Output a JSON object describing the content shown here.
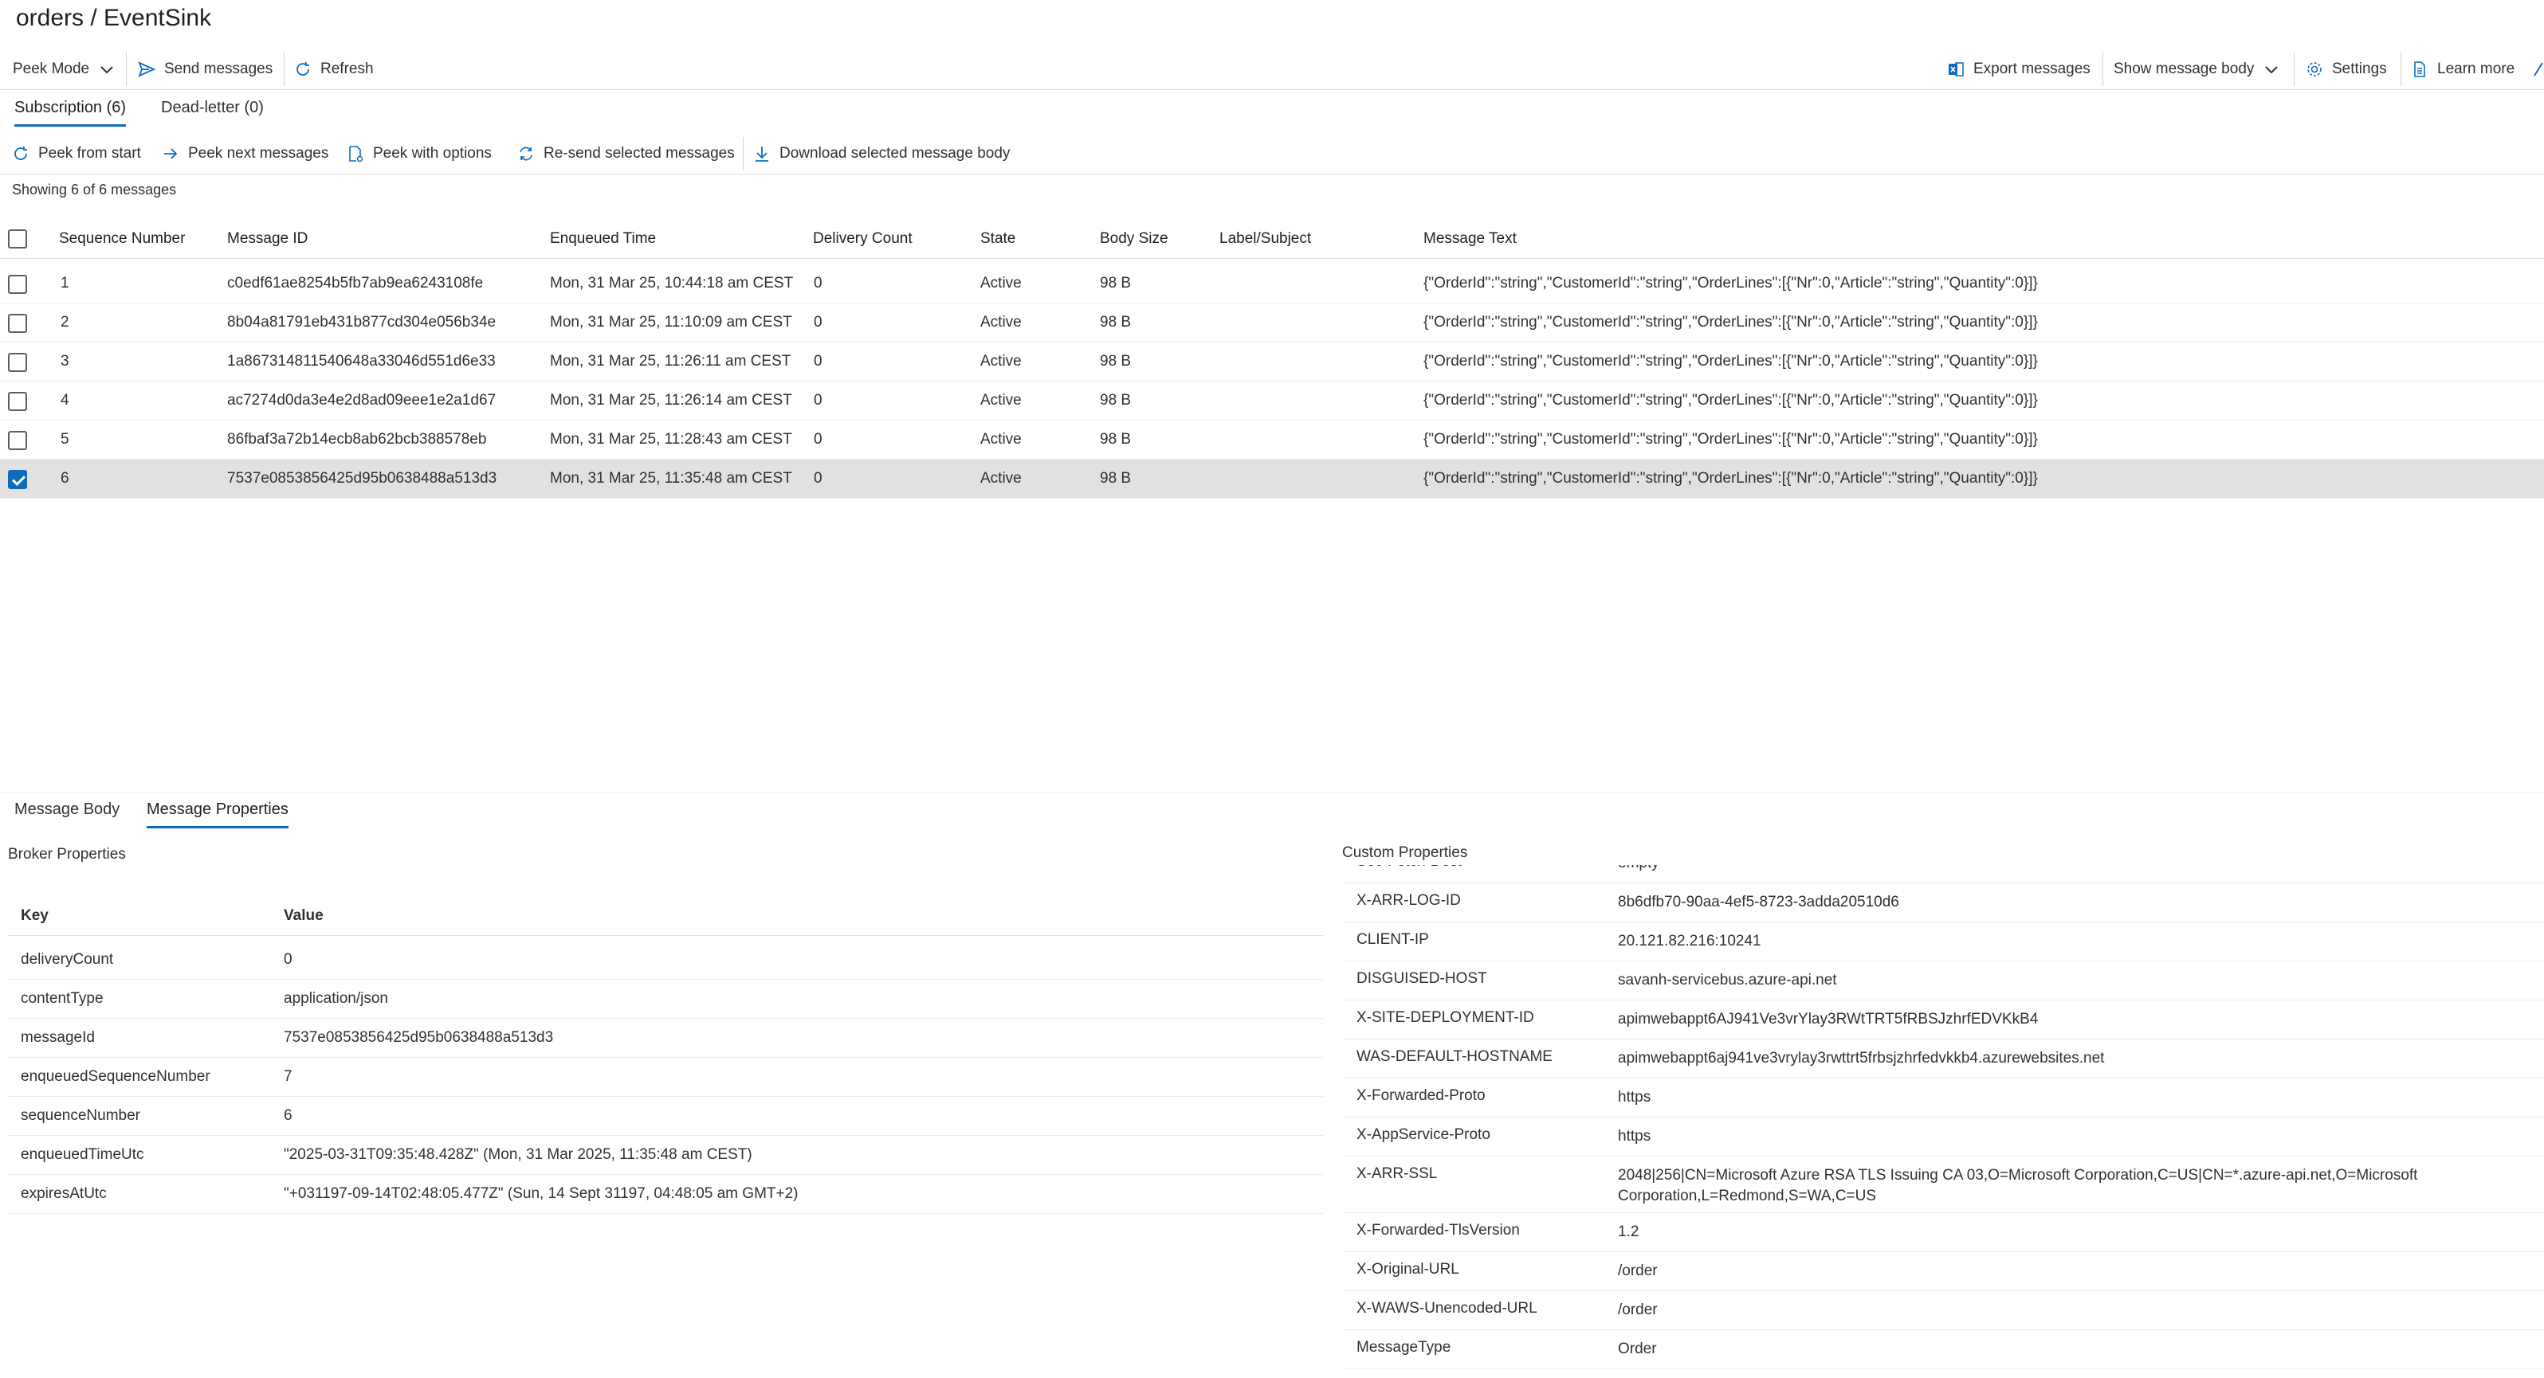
{
  "title": "orders / EventSink",
  "toolbar": {
    "peek_mode": "Peek Mode",
    "send_messages": "Send messages",
    "refresh": "Refresh",
    "export_messages": "Export messages",
    "show_message_body": "Show message body",
    "settings": "Settings",
    "learn_more": "Learn more"
  },
  "tabs": {
    "subscription": "Subscription (6)",
    "dead_letter": "Dead-letter (0)"
  },
  "actions": {
    "peek_from_start": "Peek from start",
    "peek_next": "Peek next messages",
    "peek_with_options": "Peek with options",
    "resend_selected": "Re-send selected messages",
    "download_selected": "Download selected message body"
  },
  "showing": "Showing 6 of 6 messages",
  "columns": {
    "sequence_number": "Sequence Number",
    "message_id": "Message ID",
    "enqueued_time": "Enqueued Time",
    "delivery_count": "Delivery Count",
    "state": "State",
    "body_size": "Body Size",
    "label_subject": "Label/Subject",
    "message_text": "Message Text"
  },
  "messages": [
    {
      "seq": "1",
      "id": "c0edf61ae8254b5fb7ab9ea6243108fe",
      "time": "Mon, 31 Mar 25, 10:44:18 am CEST",
      "count": "0",
      "state": "Active",
      "size": "98 B",
      "label": "",
      "text": "{\"OrderId\":\"string\",\"CustomerId\":\"string\",\"OrderLines\":[{\"Nr\":0,\"Article\":\"string\",\"Quantity\":0}]}",
      "selected": false
    },
    {
      "seq": "2",
      "id": "8b04a81791eb431b877cd304e056b34e",
      "time": "Mon, 31 Mar 25, 11:10:09 am CEST",
      "count": "0",
      "state": "Active",
      "size": "98 B",
      "label": "",
      "text": "{\"OrderId\":\"string\",\"CustomerId\":\"string\",\"OrderLines\":[{\"Nr\":0,\"Article\":\"string\",\"Quantity\":0}]}",
      "selected": false
    },
    {
      "seq": "3",
      "id": "1a867314811540648a33046d551d6e33",
      "time": "Mon, 31 Mar 25, 11:26:11 am CEST",
      "count": "0",
      "state": "Active",
      "size": "98 B",
      "label": "",
      "text": "{\"OrderId\":\"string\",\"CustomerId\":\"string\",\"OrderLines\":[{\"Nr\":0,\"Article\":\"string\",\"Quantity\":0}]}",
      "selected": false
    },
    {
      "seq": "4",
      "id": "ac7274d0da3e4e2d8ad09eee1e2a1d67",
      "time": "Mon, 31 Mar 25, 11:26:14 am CEST",
      "count": "0",
      "state": "Active",
      "size": "98 B",
      "label": "",
      "text": "{\"OrderId\":\"string\",\"CustomerId\":\"string\",\"OrderLines\":[{\"Nr\":0,\"Article\":\"string\",\"Quantity\":0}]}",
      "selected": false
    },
    {
      "seq": "5",
      "id": "86fbaf3a72b14ecb8ab62bcb388578eb",
      "time": "Mon, 31 Mar 25, 11:28:43 am CEST",
      "count": "0",
      "state": "Active",
      "size": "98 B",
      "label": "",
      "text": "{\"OrderId\":\"string\",\"CustomerId\":\"string\",\"OrderLines\":[{\"Nr\":0,\"Article\":\"string\",\"Quantity\":0}]}",
      "selected": false
    },
    {
      "seq": "6",
      "id": "7537e0853856425d95b0638488a513d3",
      "time": "Mon, 31 Mar 25, 11:35:48 am CEST",
      "count": "0",
      "state": "Active",
      "size": "98 B",
      "label": "",
      "text": "{\"OrderId\":\"string\",\"CustomerId\":\"string\",\"OrderLines\":[{\"Nr\":0,\"Article\":\"string\",\"Quantity\":0}]}",
      "selected": true
    }
  ],
  "bottom_tabs": {
    "message_body": "Message Body",
    "message_properties": "Message Properties"
  },
  "broker": {
    "label": "Broker Properties",
    "key_header": "Key",
    "value_header": "Value",
    "rows": [
      {
        "key": "deliveryCount",
        "value": "0"
      },
      {
        "key": "contentType",
        "value": "application/json"
      },
      {
        "key": "messageId",
        "value": "7537e0853856425d95b0638488a513d3"
      },
      {
        "key": "enqueuedSequenceNumber",
        "value": "7"
      },
      {
        "key": "sequenceNumber",
        "value": "6"
      },
      {
        "key": "enqueuedTimeUtc",
        "value": "\"2025-03-31T09:35:48.428Z\" (Mon, 31 Mar 2025, 11:35:48 am CEST)"
      },
      {
        "key": "expiresAtUtc",
        "value": "\"+031197-09-14T02:48:05.477Z\" (Sun, 14 Sept 31197, 04:48:05 am GMT+2)"
      }
    ]
  },
  "custom": {
    "label": "Custom Properties",
    "rows": [
      {
        "key": "Sec-Fetch-Dest",
        "value": "empty"
      },
      {
        "key": "X-ARR-LOG-ID",
        "value": "8b6dfb70-90aa-4ef5-8723-3adda20510d6"
      },
      {
        "key": "CLIENT-IP",
        "value": "20.121.82.216:10241"
      },
      {
        "key": "DISGUISED-HOST",
        "value": "savanh-servicebus.azure-api.net"
      },
      {
        "key": "X-SITE-DEPLOYMENT-ID",
        "value": "apimwebappt6AJ941Ve3vrYlay3RWtTRT5fRBSJzhrfEDVKkB4"
      },
      {
        "key": "WAS-DEFAULT-HOSTNAME",
        "value": "apimwebappt6aj941ve3vrylay3rwttrt5frbsjzhrfedvkkb4.azurewebsites.net"
      },
      {
        "key": "X-Forwarded-Proto",
        "value": "https"
      },
      {
        "key": "X-AppService-Proto",
        "value": "https"
      },
      {
        "key": "X-ARR-SSL",
        "value": "2048|256|CN=Microsoft Azure RSA TLS Issuing CA 03,O=Microsoft Corporation,C=US|CN=*.azure-api.net,O=Microsoft Corporation,L=Redmond,S=WA,C=US"
      },
      {
        "key": "X-Forwarded-TlsVersion",
        "value": "1.2"
      },
      {
        "key": "X-Original-URL",
        "value": "/order"
      },
      {
        "key": "X-WAWS-Unencoded-URL",
        "value": "/order"
      },
      {
        "key": "MessageType",
        "value": "Order"
      }
    ]
  },
  "colors": {
    "accent": "#0f6cbd",
    "selected_row": "#e1e1e1",
    "divider": "#e1dfdd"
  }
}
